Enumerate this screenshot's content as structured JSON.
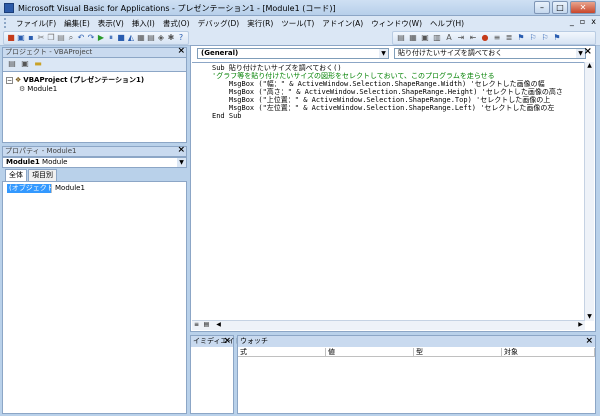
{
  "window": {
    "title": "Microsoft Visual Basic for Applications - プレゼンテーション1 - [Module1 (コード)]",
    "minimize": "–",
    "restore": "□",
    "close": "✕"
  },
  "menubar": {
    "items": [
      "ファイル(F)",
      "編集(E)",
      "表示(V)",
      "挿入(I)",
      "書式(O)",
      "デバッグ(D)",
      "実行(R)",
      "ツール(T)",
      "アドイン(A)",
      "ウィンドウ(W)",
      "ヘルプ(H)"
    ],
    "mdi_minimize": "_",
    "mdi_restore": "▫",
    "mdi_close": "x"
  },
  "project_panel": {
    "title": "プロジェクト - VBAProject",
    "close": "×",
    "root_label": "VBAProject (プレゼンテーション1)",
    "module_label": "Module1"
  },
  "properties_panel": {
    "title": "プロパティ - Module1",
    "close": "×",
    "object_name": "Module1",
    "object_type": "Module",
    "tabs": [
      "全体",
      "項目別"
    ],
    "rows": [
      {
        "name": "(オブジェクト名)",
        "value": "Module1"
      }
    ]
  },
  "code_window": {
    "object_combo": "(General)",
    "procedure_combo": "貼り付けたいサイズを調べておく",
    "close": "×",
    "lines": [
      {
        "text": "Sub 貼り付けたいサイズを調べておく()",
        "comment": false
      },
      {
        "text": "'グラフ等を貼り付けたいサイズの図形をセレクトしておいて、このプログラムを走らせる",
        "comment": true
      },
      {
        "text": "    MsgBox (\"幅：\" & ActiveWindow.Selection.ShapeRange.Width) 'セレクトした画像の幅",
        "comment": false
      },
      {
        "text": "    MsgBox (\"高さ：\" & ActiveWindow.Selection.ShapeRange.Height) 'セレクトした画像の高さ",
        "comment": false
      },
      {
        "text": "    MsgBox (\"上位置：\" & ActiveWindow.Selection.ShapeRange.Top) 'セレクトした画像の上",
        "comment": false
      },
      {
        "text": "    MsgBox (\"左位置：\" & ActiveWindow.Selection.ShapeRange.Left) 'セレクトした画像の左",
        "comment": false
      },
      {
        "text": "End Sub",
        "comment": false
      }
    ]
  },
  "immediate_panel": {
    "title": "イミディエイト",
    "close": "×"
  },
  "watch_panel": {
    "title": "ウォッチ",
    "close": "×",
    "columns": [
      "式",
      "値",
      "型",
      "対象"
    ]
  }
}
